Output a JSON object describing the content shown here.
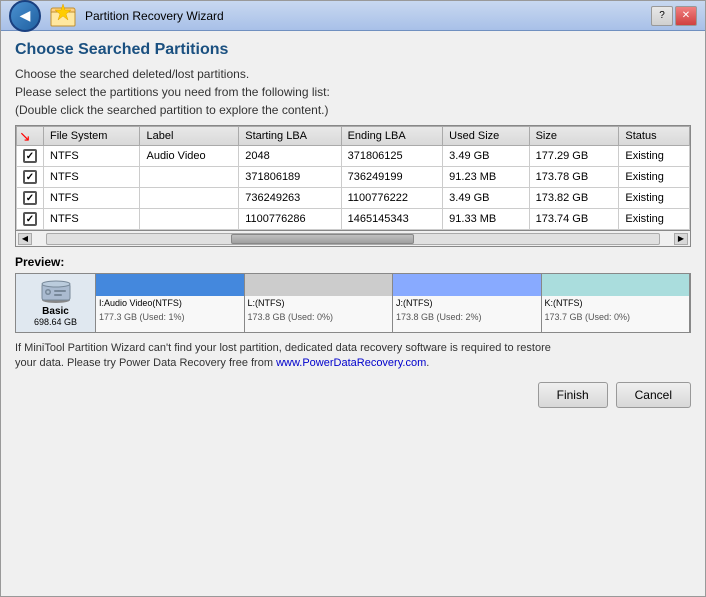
{
  "window": {
    "title": "Partition Recovery Wizard",
    "controls": {
      "help": "?",
      "close": "✕"
    }
  },
  "header": {
    "section_title": "Choose Searched Partitions",
    "instruction1": "Choose the searched deleted/lost partitions.",
    "instruction2": "Please select the partitions you need from the following list:",
    "instruction3": "(Double click the searched partition to explore the content.)"
  },
  "table": {
    "columns": [
      "",
      "File System",
      "Label",
      "Starting LBA",
      "Ending LBA",
      "Used Size",
      "Size",
      "Status"
    ],
    "rows": [
      {
        "checked": true,
        "fs": "NTFS",
        "label": "Audio Video",
        "starting_lba": "2048",
        "ending_lba": "371806125",
        "used_size": "3.49 GB",
        "size": "177.29 GB",
        "status": "Existing"
      },
      {
        "checked": true,
        "fs": "NTFS",
        "label": "",
        "starting_lba": "371806189",
        "ending_lba": "736249199",
        "used_size": "91.23 MB",
        "size": "173.78 GB",
        "status": "Existing"
      },
      {
        "checked": true,
        "fs": "NTFS",
        "label": "",
        "starting_lba": "736249263",
        "ending_lba": "1100776222",
        "used_size": "3.49 GB",
        "size": "173.82 GB",
        "status": "Existing"
      },
      {
        "checked": true,
        "fs": "NTFS",
        "label": "",
        "starting_lba": "1100776286",
        "ending_lba": "1465145343",
        "used_size": "91.33 MB",
        "size": "173.74 GB",
        "status": "Existing"
      }
    ]
  },
  "preview": {
    "label": "Preview:",
    "disk": {
      "name": "Basic",
      "size": "698.64 GB"
    },
    "partitions": [
      {
        "id": "I",
        "label": "I:Audio Video(NTFS)",
        "sub": "177.3 GB (Used: 1%)",
        "color": "#4488dd",
        "width": "25%"
      },
      {
        "id": "L",
        "label": "L:(NTFS)",
        "sub": "173.8 GB (Used: 0%)",
        "color": "#cccccc",
        "width": "25%"
      },
      {
        "id": "J",
        "label": "J:(NTFS)",
        "sub": "173.8 GB (Used: 2%)",
        "color": "#88aaff",
        "width": "25%"
      },
      {
        "id": "K",
        "label": "K:(NTFS)",
        "sub": "173.7 GB (Used: 0%)",
        "color": "#aadddd",
        "width": "25%"
      }
    ]
  },
  "footer": {
    "text1": "If MiniTool Partition Wizard can't find your lost partition, dedicated data recovery software is required to restore",
    "text2": "your data. Please try Power Data Recovery free from ",
    "link_text": "www.PowerDataRecovery.com",
    "text3": "."
  },
  "buttons": {
    "finish": "Finish",
    "cancel": "Cancel"
  }
}
